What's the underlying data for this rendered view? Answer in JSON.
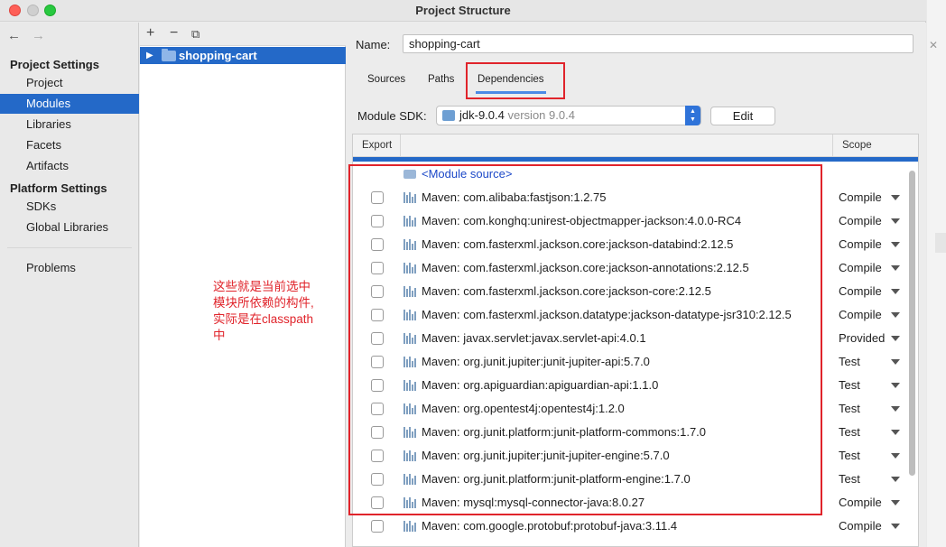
{
  "window": {
    "title": "Project Structure"
  },
  "sidebar": {
    "project_settings_title": "Project Settings",
    "project_items": [
      {
        "label": "Project"
      },
      {
        "label": "Modules"
      },
      {
        "label": "Libraries"
      },
      {
        "label": "Facets"
      },
      {
        "label": "Artifacts"
      }
    ],
    "platform_settings_title": "Platform Settings",
    "platform_items": [
      {
        "label": "SDKs"
      },
      {
        "label": "Global Libraries"
      }
    ],
    "problems_label": "Problems",
    "selected": "Modules"
  },
  "tree": {
    "toolbar": {
      "add": "+",
      "remove": "−",
      "copy": "⧉"
    },
    "module_name": "shopping-cart"
  },
  "note": {
    "lines": [
      "这些就是当前选中",
      "模块所依赖的构件,",
      "实际是在classpath",
      "中"
    ]
  },
  "content": {
    "name_label": "Name:",
    "name_value": "shopping-cart",
    "tabs": [
      {
        "label": "Sources"
      },
      {
        "label": "Paths"
      },
      {
        "label": "Dependencies"
      }
    ],
    "active_tab": "Dependencies",
    "sdk_label": "Module SDK:",
    "sdk_name": "jdk-9.0.4",
    "sdk_version": "version 9.0.4",
    "edit_label": "Edit",
    "table": {
      "col_export": "Export",
      "col_scope": "Scope",
      "module_source": "<Module source>",
      "rows": [
        {
          "name": "Maven: com.alibaba:fastjson:1.2.75",
          "scope": "Compile"
        },
        {
          "name": "Maven: com.konghq:unirest-objectmapper-jackson:4.0.0-RC4",
          "scope": "Compile"
        },
        {
          "name": "Maven: com.fasterxml.jackson.core:jackson-databind:2.12.5",
          "scope": "Compile"
        },
        {
          "name": "Maven: com.fasterxml.jackson.core:jackson-annotations:2.12.5",
          "scope": "Compile"
        },
        {
          "name": "Maven: com.fasterxml.jackson.core:jackson-core:2.12.5",
          "scope": "Compile"
        },
        {
          "name": "Maven: com.fasterxml.jackson.datatype:jackson-datatype-jsr310:2.12.5",
          "scope": "Compile"
        },
        {
          "name": "Maven: javax.servlet:javax.servlet-api:4.0.1",
          "scope": "Provided"
        },
        {
          "name": "Maven: org.junit.jupiter:junit-jupiter-api:5.7.0",
          "scope": "Test"
        },
        {
          "name": "Maven: org.apiguardian:apiguardian-api:1.1.0",
          "scope": "Test"
        },
        {
          "name": "Maven: org.opentest4j:opentest4j:1.2.0",
          "scope": "Test"
        },
        {
          "name": "Maven: org.junit.platform:junit-platform-commons:1.7.0",
          "scope": "Test"
        },
        {
          "name": "Maven: org.junit.jupiter:junit-jupiter-engine:5.7.0",
          "scope": "Test"
        },
        {
          "name": "Maven: org.junit.platform:junit-platform-engine:1.7.0",
          "scope": "Test"
        },
        {
          "name": "Maven: mysql:mysql-connector-java:8.0.27",
          "scope": "Compile"
        },
        {
          "name": "Maven: com.google.protobuf:protobuf-java:3.11.4",
          "scope": "Compile"
        }
      ]
    }
  },
  "colors": {
    "selection": "#2469c8",
    "annotation": "#e0242b",
    "module_source": "#1d49c8"
  }
}
